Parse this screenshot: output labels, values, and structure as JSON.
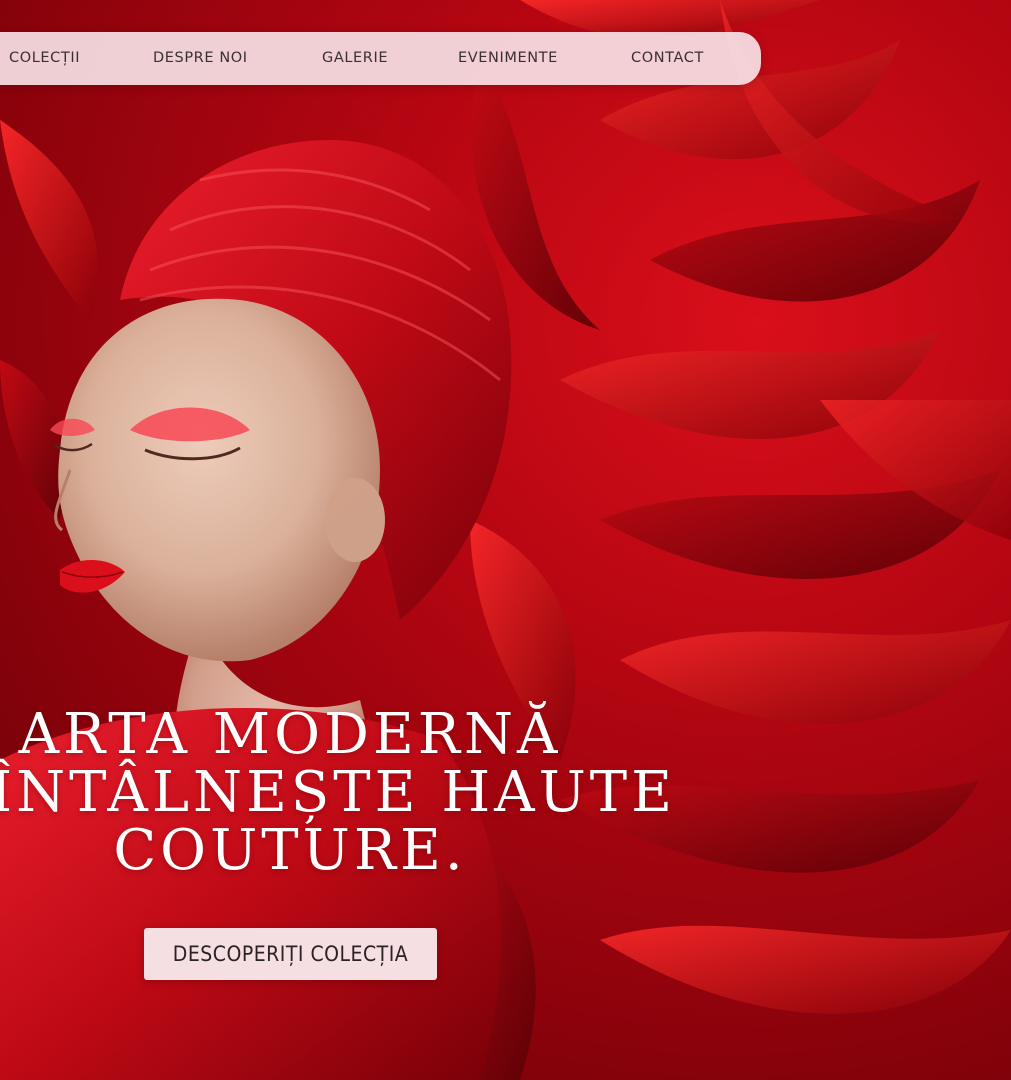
{
  "navigation": {
    "items": [
      {
        "label": "COLECȚII"
      },
      {
        "label": "DESPRE NOI"
      },
      {
        "label": "GALERIE"
      },
      {
        "label": "EVENIMENTE"
      },
      {
        "label": "CONTACT"
      }
    ]
  },
  "hero": {
    "headline_lines": [
      "ARTA MODERNĂ",
      "ÎNTÂLNEȘTE HAUTE",
      "COUTURE."
    ],
    "cta_label": "DESCOPERIȚI COLECȚIA"
  },
  "colors": {
    "primary_red": "#c8071a",
    "nav_background": "#f6e2e6",
    "text_dark": "#3a3032",
    "headline_text": "#ffffff"
  }
}
